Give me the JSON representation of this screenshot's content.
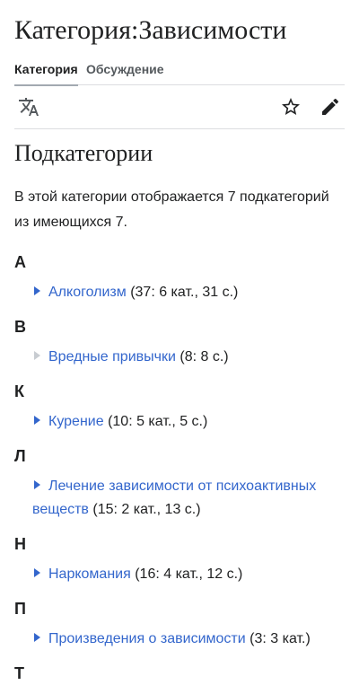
{
  "page": {
    "title": "Категория:Зависимости"
  },
  "tabs": [
    {
      "label": "Категория",
      "active": true
    },
    {
      "label": "Обсуждение",
      "active": false
    }
  ],
  "toolbar": {
    "language_icon": "translate-icon",
    "watch_icon": "star-icon",
    "edit_icon": "pencil-icon"
  },
  "content": {
    "heading": "Подкатегории",
    "intro": "В этой категории отображается 7 подкатегорий из имеющихся 7.",
    "groups": [
      {
        "letter": "А",
        "items": [
          {
            "title": "Алкоголизм",
            "count": "(37: 6 кат., 31 с.)",
            "has_children": true
          }
        ]
      },
      {
        "letter": "В",
        "items": [
          {
            "title": "Вредные привычки",
            "count": "(8: 8 с.)",
            "has_children": false
          }
        ]
      },
      {
        "letter": "К",
        "items": [
          {
            "title": "Курение",
            "count": "(10: 5 кат., 5 с.)",
            "has_children": true
          }
        ]
      },
      {
        "letter": "Л",
        "items": [
          {
            "title": "Лечение зависимости от психоактивных веществ",
            "count": "(15: 2 кат., 13 с.)",
            "has_children": true
          }
        ]
      },
      {
        "letter": "Н",
        "items": [
          {
            "title": "Наркомания",
            "count": "(16: 4 кат., 12 с.)",
            "has_children": true
          }
        ]
      },
      {
        "letter": "П",
        "items": [
          {
            "title": "Произведения о зависимости",
            "count": "(3: 3 кат.)",
            "has_children": true
          }
        ]
      },
      {
        "letter": "Т",
        "items": []
      }
    ]
  },
  "colors": {
    "link": "#3366cc",
    "text": "#202122",
    "divider": "#dcdde0",
    "tree_toggle_empty": "#c8ccd1"
  }
}
